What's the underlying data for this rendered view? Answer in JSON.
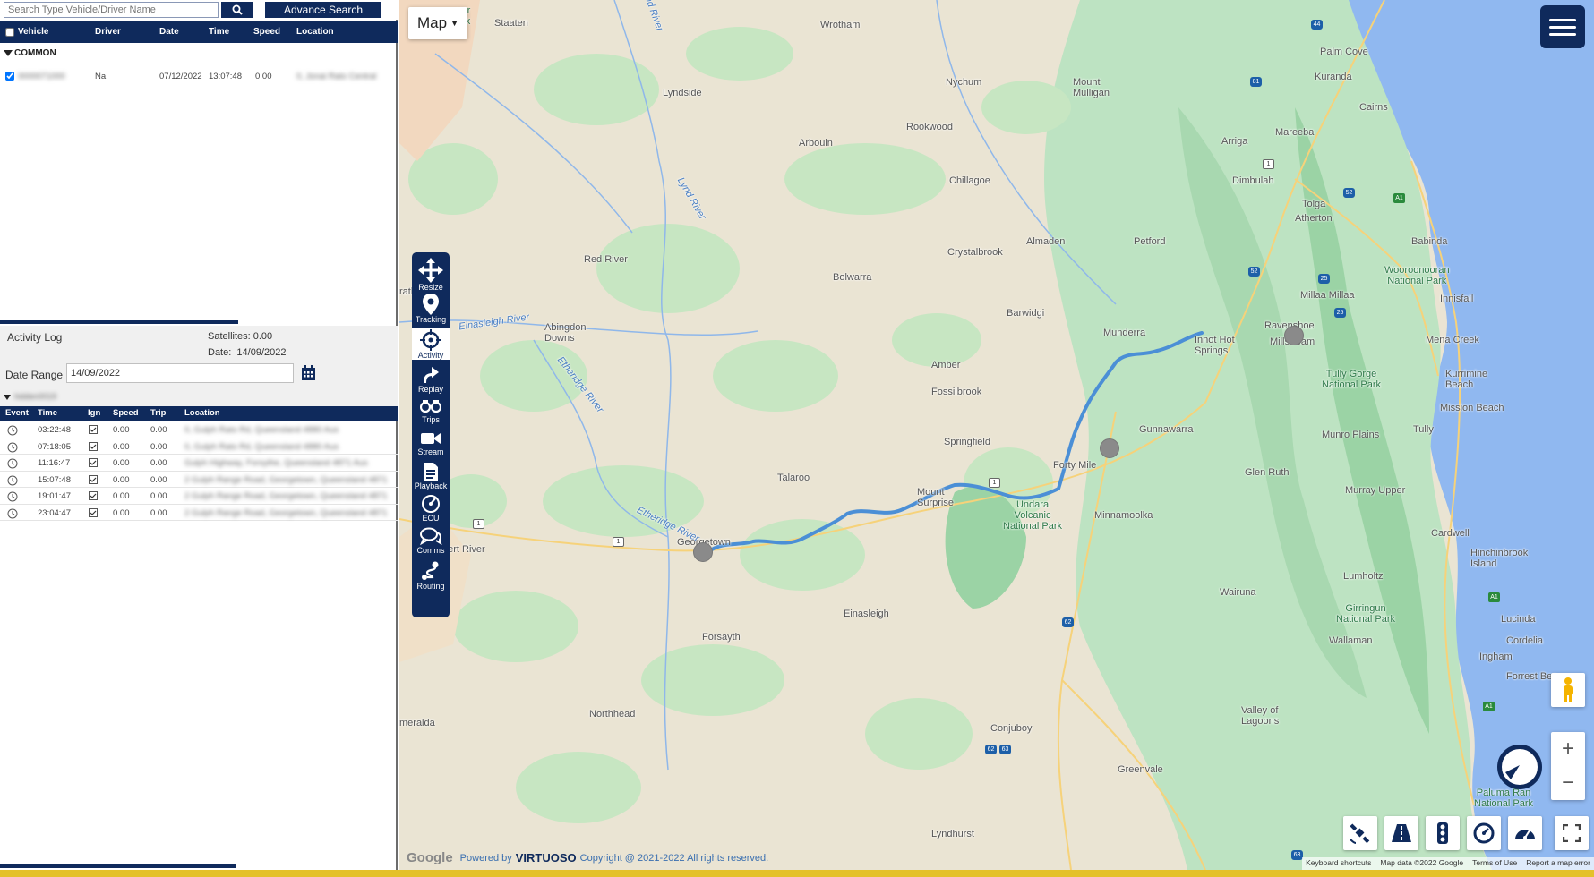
{
  "search": {
    "placeholder": "Search Type Vehicle/Driver Name",
    "advance_label": "Advance Search"
  },
  "vehicle_table": {
    "columns": [
      "Vehicle",
      "Driver",
      "Date",
      "Time",
      "Speed",
      "Location"
    ],
    "group": "COMMON",
    "rows": [
      {
        "vehicle": "0000071000",
        "driver": "Na",
        "date": "07/12/2022",
        "time": "13:07:48",
        "speed": "0.00",
        "location": "0, Jonai Rato Central"
      }
    ]
  },
  "activity": {
    "title": "Activity Log",
    "satellites": "Satellites: 0.00",
    "date_label": "Date:",
    "date_value": "14/09/2022",
    "date_range_label": "Date Range",
    "date_range_value": "14/09/2022",
    "group": "hidden0019",
    "columns": [
      "Event",
      "Time",
      "Ign",
      "Speed",
      "Trip",
      "Location"
    ],
    "rows": [
      {
        "time": "03:22:48",
        "speed": "0.00",
        "trip": "0.00",
        "location": "0, Gulph Rato Rd, Queensland 4880 Aus"
      },
      {
        "time": "07:18:05",
        "speed": "0.00",
        "trip": "0.00",
        "location": "0, Gulph Rato Rd, Queensland 4880 Aus"
      },
      {
        "time": "11:16:47",
        "speed": "0.00",
        "trip": "0.00",
        "location": "Gulph Highway, Forsythe, Queensland 4871 Aus"
      },
      {
        "time": "15:07:48",
        "speed": "0.00",
        "trip": "0.00",
        "location": "2 Gulph Range Road, Georgetown, Queensland 4871"
      },
      {
        "time": "19:01:47",
        "speed": "0.00",
        "trip": "0.00",
        "location": "2 Gulph Range Road, Georgetown, Queensland 4871"
      },
      {
        "time": "23:04:47",
        "speed": "0.00",
        "trip": "0.00",
        "location": "2 Gulph Range Road, Georgetown, Queensland 4871"
      }
    ]
  },
  "map": {
    "type_label": "Map",
    "tools": [
      "Resize",
      "Tracking",
      "Activity",
      "Replay",
      "Trips",
      "Stream",
      "Playback",
      "ECU",
      "Comms",
      "Routing"
    ],
    "active_tool": "Activity",
    "labels": {
      "staaten": "Staaten",
      "wrotham": "Wrotham",
      "nychum": "Nychum",
      "mount_mulligan": "Mount\nMulligan",
      "rookwood": "Rookwood",
      "arbouin": "Arbouin",
      "lyndside": "Lyndside",
      "chillagoe": "Chillagoe",
      "dimbulah": "Dimbulah",
      "mareeba": "Mareeba",
      "arriga": "Arriga",
      "kuranda": "Kuranda",
      "palm_cove": "Palm Cove",
      "cairns": "Cairns",
      "tolga": "Tolga",
      "atherton": "Atherton",
      "babinda": "Babinda",
      "wooroonooran": "Wooroonooran\nNational Park",
      "almaden": "Almaden",
      "petford": "Petford",
      "crystalbrook": "Crystalbrook",
      "bolwarra": "Bolwarra",
      "red_river": "Red River",
      "strathmore": "rathmore",
      "millaa": "Millaa Millaa",
      "innisfail": "Innisfail",
      "barwidgi": "Barwidgi",
      "munderra": "Munderra",
      "innot": "Innot Hot\nSprings",
      "ravenshoe": "Ravenshoe",
      "millstream": "Millstream",
      "mena_creek": "Mena Creek",
      "abingdon": "Abingdon\nDowns",
      "amber": "Amber",
      "tully_gorge": "Tully Gorge\nNational Park",
      "kurrimine": "Kurrimine\nBeach",
      "mission": "Mission Beach",
      "fossilbrook": "Fossilbrook",
      "gunnawarra": "Gunnawarra",
      "munro": "Munro Plains",
      "tully": "Tully",
      "springfield": "Springfield",
      "forty_mile": "Forty Mile",
      "glen_ruth": "Glen Ruth",
      "talaroo": "Talaroo",
      "mount_surprise": "Mount\nSurprise",
      "murray": "Murray Upper",
      "undara": "Undara\nVolcanic\nNational Park",
      "minnamoolka": "Minnamoolka",
      "cardwell": "Cardwell",
      "georgetown": "Georgetown",
      "hinchinbrook": "Hinchinbrook\nIsland",
      "gilbert": "bert River",
      "lumholtz": "Lumholtz",
      "wairuna": "Wairuna",
      "einasleigh": "Einasleigh",
      "girringun": "Girringun\nNational Park",
      "lucinda": "Lucinda",
      "forsayth": "Forsayth",
      "wallaman": "Wallaman",
      "cordelia": "Cordelia",
      "ingham": "Ingham",
      "forrest": "Forrest Bea",
      "northhead": "Northhead",
      "valley": "Valley of\nLagoons",
      "emeralda": "meralda",
      "conjuboy": "Conjuboy",
      "greenvale": "Greenvale",
      "paluma": "Paluma Ran\nNational Park",
      "lyndhurst": "Lyndhurst",
      "einasleigh_river": "Einasleigh River",
      "etheridge_river1": "Etheridge River",
      "etheridge_river2": "Etheridge River",
      "lynd_river1": "Lynd River",
      "lynd_river2": "Lynd River",
      "park_top": "ver\nark"
    },
    "shields": [
      "44",
      "81",
      "1",
      "52",
      "A1",
      "52",
      "25",
      "25",
      "1",
      "1",
      "1",
      "62",
      "62",
      "63",
      "63",
      "A1",
      "A1"
    ],
    "footer_powered": "Powered by",
    "footer_brand": "VIRTUOSO",
    "footer_copy": "Copyright @ 2021-2022 All rights reserved.",
    "google": "Google",
    "attribution": [
      "Keyboard shortcuts",
      "Map data ©2022 Google",
      "Terms of Use",
      "Report a map error"
    ]
  },
  "colors": {
    "navy": "#0f2a5c",
    "route": "#4b8fd6",
    "accent_yellow": "#e4c12a"
  }
}
